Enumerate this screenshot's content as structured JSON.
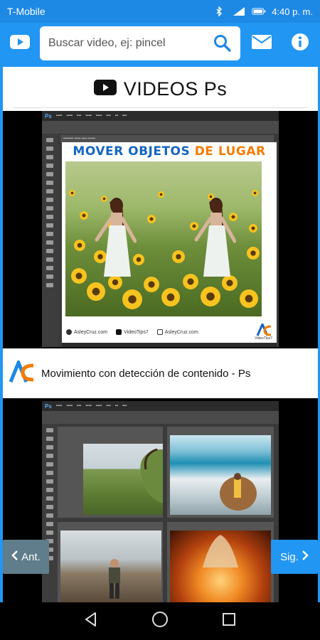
{
  "status_bar": {
    "carrier": "T-Mobile",
    "time": "4:40 p. m.",
    "icons": [
      "bluetooth-icon",
      "signal-icon",
      "battery-icon"
    ]
  },
  "app_bar": {
    "youtube_icon": "youtube-icon",
    "search": {
      "placeholder": "Buscar video, ej: pincel",
      "value": ""
    },
    "search_icon": "search-icon",
    "mail_icon": "mail-icon",
    "info_icon": "info-icon"
  },
  "page": {
    "title": "VIDEOS Ps",
    "title_icon": "youtube-icon"
  },
  "videos": [
    {
      "thumbnail_banner": {
        "part1": "MOVER OBJETOS",
        "part2": "DE LUGAR"
      },
      "thumbnail_footer": [
        "AsleyCruz.com",
        "VideoTips7",
        "AsleyCruz.com"
      ],
      "thumbnail_logo": "VideoTips7",
      "caption": "Movimiento con detección de contenido - Ps",
      "channel_logo": "videotips-logo-icon"
    },
    {
      "caption": ""
    }
  ],
  "nav": {
    "prev_label": "Ant.",
    "next_label": "Sig."
  },
  "system_nav": [
    "back-icon",
    "home-icon",
    "recents-icon"
  ],
  "colors": {
    "primary": "#2196f3",
    "prev_button": "#607d8b",
    "banner_blue": "#1565c0",
    "banner_orange": "#f57c00"
  }
}
